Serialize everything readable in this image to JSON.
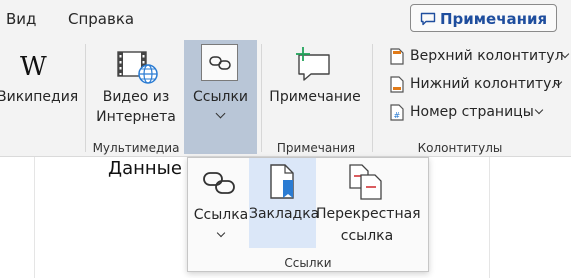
{
  "menu": {
    "items": [
      "Вид",
      "Справка"
    ],
    "comments_button": "Примечания"
  },
  "ribbon": {
    "wikipedia_label": "Википедия",
    "video_label_line1": "Видео из",
    "video_label_line2": "Интернета",
    "links_label": "Ссылки",
    "comment_label": "Примечание",
    "header_label": "Верхний колонтитул",
    "footer_label": "Нижний колонтитул",
    "page_number_label": "Номер страницы",
    "groups": {
      "multimedia": "Мультимедиа",
      "comments": "Примечания",
      "header_footer": "Колонтитулы"
    }
  },
  "document": {
    "text": "Данные"
  },
  "dropdown": {
    "link_label": "Ссылка",
    "bookmark_label": "Закладка",
    "cross_ref_line1": "Перекрестная",
    "cross_ref_line2": "ссылка",
    "group_label": "Ссылки"
  },
  "colors": {
    "accent": "#1f4e9e",
    "selected_button": "#b9c6d7",
    "hover_item": "#dbe7f8",
    "bookmark_blue": "#2b7cd3",
    "red_mark": "#d13438"
  },
  "icons": [
    "comment-icon",
    "wikipedia-icon",
    "online-video-icon",
    "link-icon",
    "new-comment-icon",
    "header-icon",
    "footer-icon",
    "page-number-icon",
    "bookmark-icon",
    "cross-reference-icon"
  ]
}
